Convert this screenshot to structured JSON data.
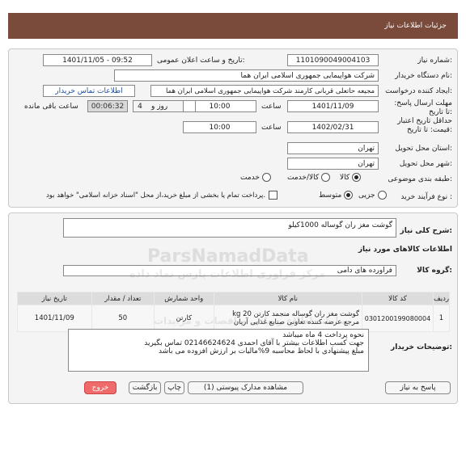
{
  "header": {
    "title": "جزئیات اطلاعات نیاز"
  },
  "form": {
    "need_number_label": "شماره نیاز:",
    "need_number": "1101090049004103",
    "announce_label": "تاریخ و ساعت اعلان عمومی:",
    "announce_value": "1401/11/05 - 09:52",
    "buyer_org_label": "نام دستگاه خریدار:",
    "buyer_org": "شرکت هواپیمایی جمهوری اسلامی ایران هما",
    "requester_label": "ایجاد کننده درخواست:",
    "requester": "مجیعه حاتعلی قربانی کارمند شرکت هواپیمایی جمهوری اسلامی ایران هما",
    "contact_link": "اطلاعات تماس خریدار",
    "deadline_label": "مهلت ارسال پاسخ: تا تاریخ:",
    "deadline_date": "1401/11/09",
    "time_label": "ساعت",
    "deadline_time": "10:00",
    "day_and": "روز و",
    "days": "4",
    "remaining_time": "00:06:32",
    "remaining_label": "ساعت باقی مانده",
    "price_validity_label": "حداقل تاریخ اعتبار قیمت: تا تاریخ:",
    "price_validity_date": "1402/02/31",
    "price_time_label": "ساعت",
    "price_validity_time": "10:00",
    "province_label": "استان محل تحویل:",
    "province": "تهران",
    "city_label": "شهر محل تحویل:",
    "city": "تهران",
    "category_label": "طبقه بندی موضوعی:",
    "category_options": [
      "کالا",
      "کالا/خدمت",
      "خدمت"
    ],
    "category_selected": "کالا",
    "process_label": "نوع فرآیند خرید :",
    "process_options": [
      "جزیی",
      "متوسط"
    ],
    "process_selected": "متوسط",
    "payment_note": "پرداخت تمام یا بخشی از مبلغ خرید،از محل \"اسناد خزانه اسلامی\" خواهد بود."
  },
  "summary": {
    "label": "شرح کلی نیاز:",
    "value": "گوشت مغز ران گوساله 1000کیلو"
  },
  "items_section": {
    "title": "اطلاعات کالاهای مورد نیاز",
    "group_label": "گروه کالا:",
    "group_value": "فراورده های دامی",
    "columns": [
      "ردیف",
      "کد کالا",
      "نام کالا",
      "واحد شمارش",
      "تعداد / مقدار",
      "تاریخ نیاز"
    ],
    "rows": [
      {
        "row": "1",
        "code": "0301200199080004",
        "name": "گوشت مغز ران گوساله منجمد کارتن 20 kg مرجع عرضه کننده تعاونی صنایع غذایی آریان",
        "unit": "کارتن",
        "qty": "50",
        "date": "1401/11/09"
      }
    ]
  },
  "buyer_notes": {
    "label": "توضیحات خریدار:",
    "lines": [
      "نحوه پرداخت 4 ماه  میباشد",
      "جهت کسب اطلاعات بیشتر با آقای احمدی  02146624624 تماس بگیرید",
      "مبلغ پیشنهادی با لحاظ محاسبه 9%مالیات بر ارزش افزوده می باشد"
    ]
  },
  "buttons": {
    "reply": "پاسخ به نیاز",
    "attachments": "مشاهده مدارک پیوستی (1)",
    "print": "چاپ",
    "back": "بازگشت",
    "exit": "خروج"
  },
  "watermark": {
    "brand": "ParsNamadData",
    "tagline": "مرکز فراوری اطلاعات پارس نماد داده",
    "subtitle": "سامانه اطلاع رسانی مناقصات و مزایدات"
  }
}
